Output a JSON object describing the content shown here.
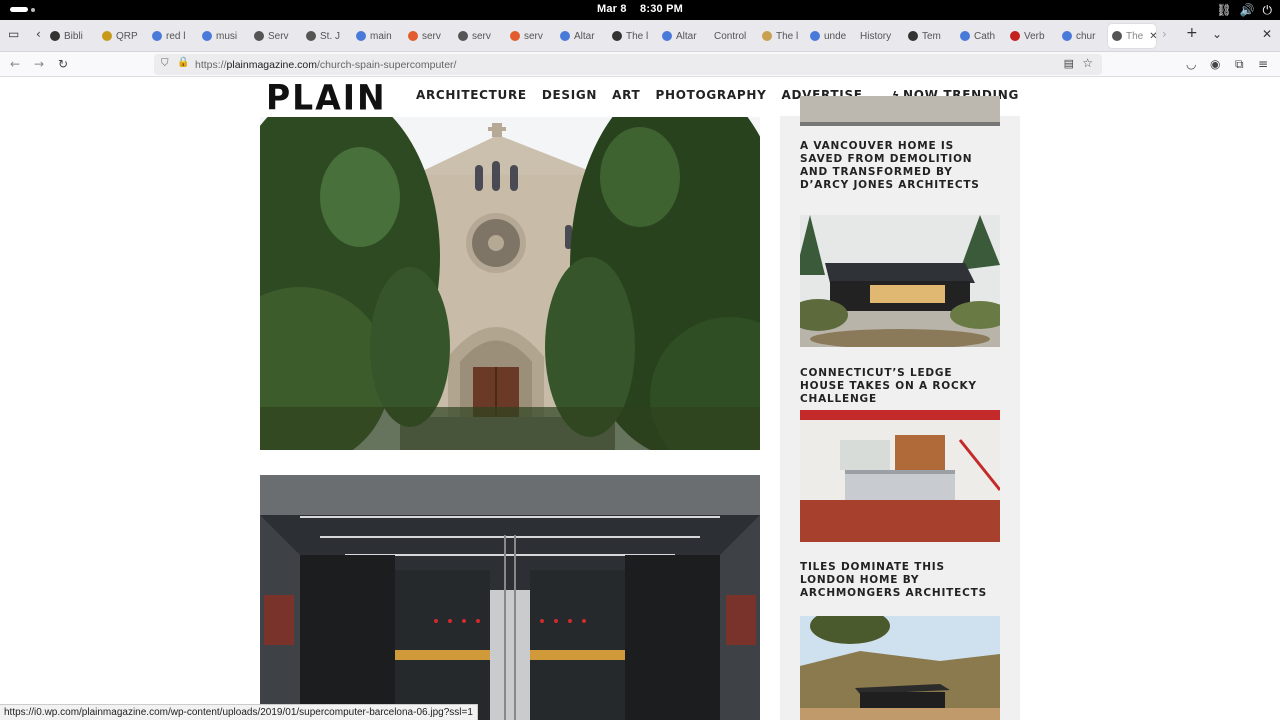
{
  "system": {
    "date": "Mar 8",
    "time": "8:30 PM"
  },
  "browser": {
    "tabs": [
      {
        "label": "Bibli",
        "fav": "W"
      },
      {
        "label": "QRP",
        "fav": "Q"
      },
      {
        "label": "red l",
        "fav": "G"
      },
      {
        "label": "musi",
        "fav": "G"
      },
      {
        "label": "Serv",
        "fav": "S"
      },
      {
        "label": "St. J",
        "fav": "S"
      },
      {
        "label": "main",
        "fav": "G"
      },
      {
        "label": "serv",
        "fav": "R"
      },
      {
        "label": "serv",
        "fav": "S"
      },
      {
        "label": "serv",
        "fav": "R"
      },
      {
        "label": "Altar",
        "fav": "A"
      },
      {
        "label": "The l",
        "fav": "T"
      },
      {
        "label": "Altar",
        "fav": "G"
      },
      {
        "label": "Control",
        "fav": ""
      },
      {
        "label": "The l",
        "fav": "+"
      },
      {
        "label": "unde",
        "fav": "G"
      },
      {
        "label": "History",
        "fav": ""
      },
      {
        "label": "Tem",
        "fav": "W"
      },
      {
        "label": "Cath",
        "fav": "G"
      },
      {
        "label": "Verb",
        "fav": "SW"
      },
      {
        "label": "chur",
        "fav": "G"
      },
      {
        "label": "The",
        "fav": "P"
      }
    ],
    "url_domain": "plainmagazine.com",
    "url_prefix": "https://",
    "url_path": "/church-spain-supercomputer/",
    "status_url": "https://i0.wp.com/plainmagazine.com/wp-content/uploads/2019/01/supercomputer-barcelona-06.jpg?ssl=1"
  },
  "site": {
    "logo": "PLAIN",
    "nav": [
      "ARCHITECTURE",
      "DESIGN",
      "ART",
      "PHOTOGRAPHY",
      "ADVERTISE"
    ],
    "trending": "NOW TRENDING"
  },
  "sidebar": {
    "items": [
      {
        "title": "A VANCOUVER HOME IS SAVED FROM DEMOLITION AND TRANSFORMED BY D’ARCY JONES ARCHITECTS"
      },
      {
        "title": "CONNECTICUT’S LEDGE HOUSE TAKES ON A ROCKY CHALLENGE"
      },
      {
        "title": "TILES DOMINATE THIS LONDON HOME BY ARCHMONGERS ARCHITECTS"
      }
    ]
  },
  "icons": {
    "network": "network-icon",
    "volume": "volume-icon",
    "power": "power-icon",
    "bolt": "lightning-icon"
  }
}
